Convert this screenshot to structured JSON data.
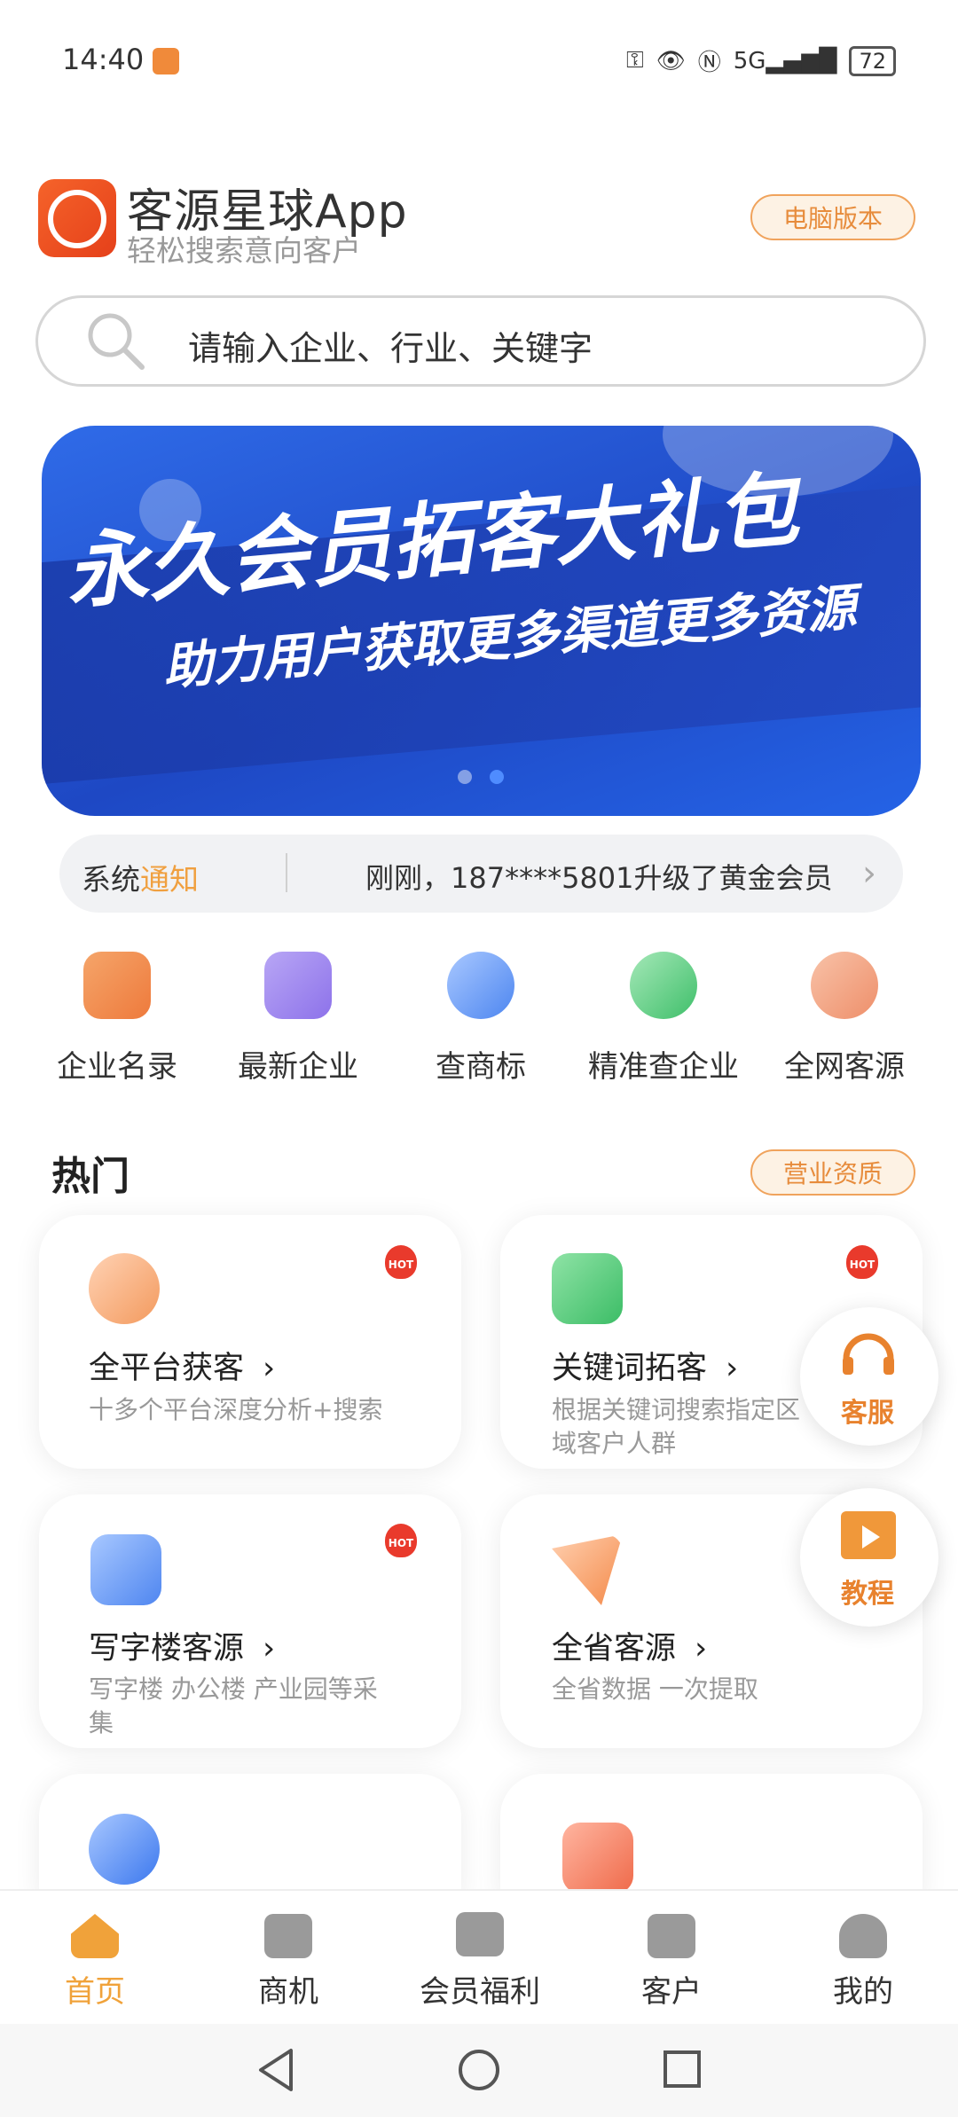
{
  "status_bar": {
    "time": "14:40",
    "signal": "5G",
    "battery": "72"
  },
  "header": {
    "app_name": "客源星球App",
    "tagline": "轻松搜索意向客户",
    "pc_version_button": "电脑版本"
  },
  "search": {
    "placeholder": "请输入企业、行业、关键字"
  },
  "banner": {
    "title": "永久会员拓客大礼包",
    "subtitle": "助力用户获取更多渠道更多资源"
  },
  "notice": {
    "label_prefix": "系统",
    "label_highlight": "通知",
    "message": "刚刚，187****5801升级了黄金会员"
  },
  "quick_menu": [
    {
      "label": "企业名录",
      "icon": "directory-icon"
    },
    {
      "label": "最新企业",
      "icon": "building-icon"
    },
    {
      "label": "查商标",
      "icon": "trademark-icon"
    },
    {
      "label": "精准查企业",
      "icon": "enterprise-search-icon"
    },
    {
      "label": "全网客源",
      "icon": "users-icon"
    }
  ],
  "hot_section": {
    "title": "热门",
    "qualification_button": "营业资质",
    "cards": [
      {
        "title": "全平台获客",
        "desc": "十多个平台深度分析+搜索",
        "hot": "HOT"
      },
      {
        "title": "关键词拓客",
        "desc": "根据关键词搜索指定区域客户人群",
        "hot": "HOT"
      },
      {
        "title": "写字楼客源",
        "desc": "写字楼 办公楼 产业园等采集",
        "hot": "HOT"
      },
      {
        "title": "全省客源",
        "desc": "全省数据 一次提取"
      }
    ]
  },
  "floating": {
    "service": "客服",
    "tutorial": "教程"
  },
  "tabbar": [
    {
      "label": "首页",
      "active": true
    },
    {
      "label": "商机"
    },
    {
      "label": "会员福利"
    },
    {
      "label": "客户"
    },
    {
      "label": "我的"
    }
  ],
  "colors": {
    "accent": "#e8952e",
    "banner_blue": "#2454d6",
    "hot_red": "#e93a2c"
  }
}
